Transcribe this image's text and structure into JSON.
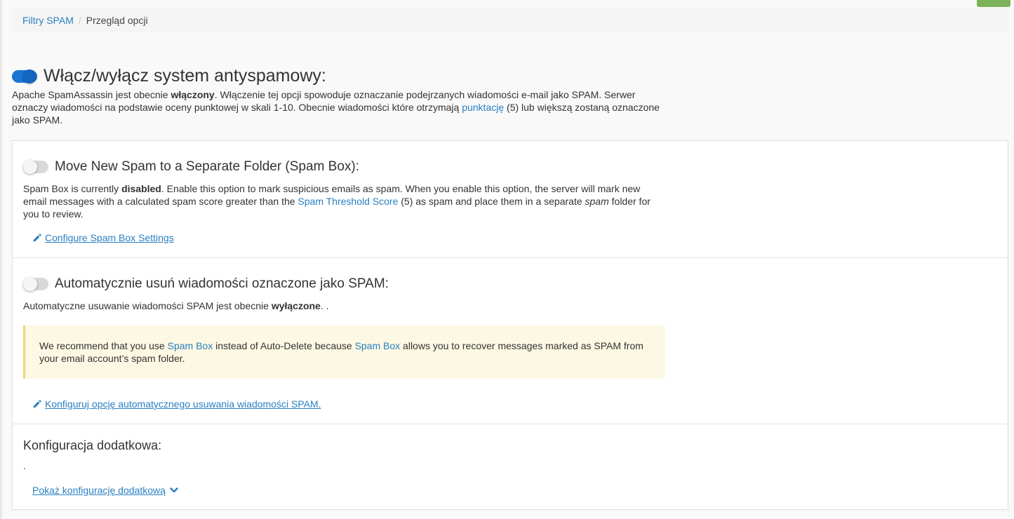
{
  "breadcrumb": {
    "parent": "Filtry SPAM",
    "separator": "/",
    "current": "Przegląd opcji"
  },
  "main": {
    "toggle_state": "on",
    "title": "Włącz/wyłącz system antyspamowy:",
    "desc_part1": "Apache SpamAssassin jest obecnie ",
    "desc_status": "włączony",
    "desc_part2": ". Włączenie tej opcji spowoduje oznaczanie podejrzanych wiadomości e-mail jako SPAM. Serwer oznaczy wiadomości na podstawie oceny punktowej w skali 1-10. Obecnie wiadomości które otrzymają ",
    "desc_link": "punktację",
    "desc_part3": " (5) lub większą zostaną oznaczone jako SPAM."
  },
  "spam_box": {
    "toggle_state": "off",
    "title": "Move New Spam to a Separate Folder (Spam Box):",
    "desc_part1": "Spam Box is currently ",
    "desc_status": "disabled",
    "desc_part2": ". Enable this option to mark suspicious emails as spam. When you enable this option, the server will mark new email messages with a calculated spam score greater than the ",
    "desc_link": "Spam Threshold Score",
    "desc_part3": " (5) as spam and place them in a separate ",
    "desc_em": "spam",
    "desc_part4": " folder for you to review.",
    "action_label": "Configure Spam Box Settings"
  },
  "auto_delete": {
    "toggle_state": "off",
    "title": "Automatycznie usuń wiadomości oznaczone jako SPAM:",
    "desc_part1": "Automatyczne usuwanie wiadomości SPAM jest obecnie ",
    "desc_status": "wyłączone",
    "desc_part2": ". .",
    "alert_part1": "We recommend that you use ",
    "alert_link1": "Spam Box",
    "alert_part2": " instead of Auto-Delete because ",
    "alert_link2": "Spam Box",
    "alert_part3": " allows you to recover messages marked as SPAM from your email account’s spam folder.",
    "action_label": "Konfiguruj opcję automatycznego usuwania wiadomości SPAM."
  },
  "additional": {
    "title": "Konfiguracja dodatkowa:",
    "desc": ".",
    "action_label": "Pokaż konfigurację dodatkową"
  },
  "colors": {
    "link": "#2a7fc1",
    "toggle_on": "#1976d2",
    "alert_bg": "#fcf8e3",
    "alert_border": "#f0d475",
    "corner_tab": "#7cb35a"
  }
}
